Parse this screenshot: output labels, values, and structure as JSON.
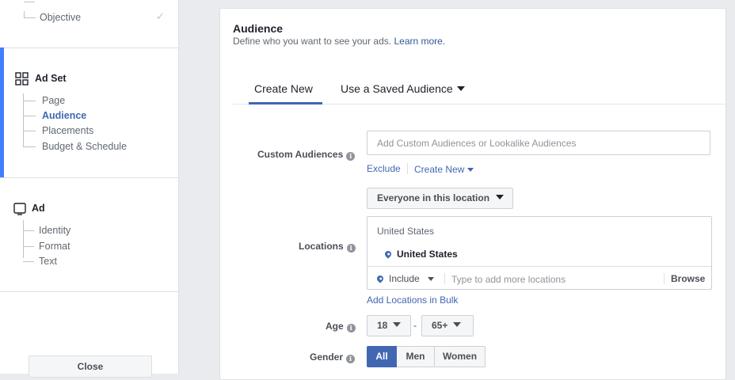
{
  "sidebar": {
    "objective": {
      "label": "Objective"
    },
    "ad_set": {
      "title": "Ad Set",
      "items": [
        {
          "label": "Page"
        },
        {
          "label": "Audience"
        },
        {
          "label": "Placements"
        },
        {
          "label": "Budget & Schedule"
        }
      ]
    },
    "ad": {
      "title": "Ad",
      "items": [
        {
          "label": "Identity"
        },
        {
          "label": "Format"
        },
        {
          "label": "Text"
        }
      ]
    },
    "close_label": "Close"
  },
  "audience": {
    "title": "Audience",
    "description": "Define who you want to see your ads.",
    "learn_more": "Learn more.",
    "tabs": [
      {
        "label": "Create New"
      },
      {
        "label": "Use a Saved Audience"
      }
    ],
    "custom_audiences": {
      "label": "Custom Audiences",
      "placeholder": "Add Custom Audiences or Lookalike Audiences",
      "exclude_label": "Exclude",
      "create_new_label": "Create New"
    },
    "locations": {
      "label": "Locations",
      "scope_dropdown": "Everyone in this location",
      "country": "United States",
      "selected_location": "United States",
      "include_label": "Include",
      "search_placeholder": "Type to add more locations",
      "browse_label": "Browse",
      "bulk_link": "Add Locations in Bulk"
    },
    "age": {
      "label": "Age",
      "min": "18",
      "separator": "-",
      "max": "65+"
    },
    "gender": {
      "label": "Gender",
      "options": [
        {
          "label": "All"
        },
        {
          "label": "Men"
        },
        {
          "label": "Women"
        }
      ],
      "selected": "All"
    }
  },
  "colors": {
    "accent": "#4267b2",
    "active_bar": "#4080ff"
  }
}
